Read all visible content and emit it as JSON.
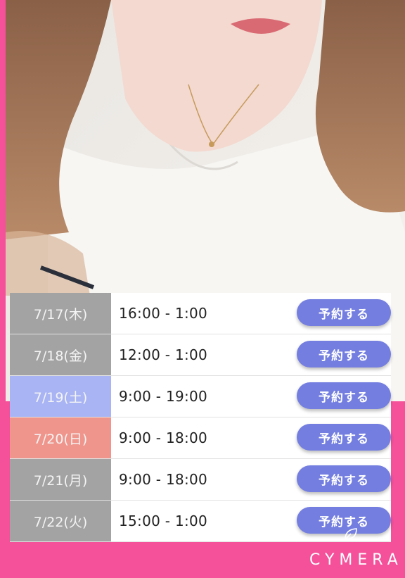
{
  "photo": {
    "alt_icon": "photo"
  },
  "schedule": {
    "reserve_label": "予約する",
    "rows": [
      {
        "date": "7/17(木)",
        "time": "16:00 - 1:00",
        "date_color": "#a3a3a3"
      },
      {
        "date": "7/18(金)",
        "time": "12:00 - 1:00",
        "date_color": "#a3a3a3"
      },
      {
        "date": "7/19(土)",
        "time": "9:00 - 19:00",
        "date_color": "#a8b4f4"
      },
      {
        "date": "7/20(日)",
        "time": "9:00 - 18:00",
        "date_color": "#f0958c"
      },
      {
        "date": "7/21(月)",
        "time": "9:00 - 18:00",
        "date_color": "#a3a3a3"
      },
      {
        "date": "7/22(火)",
        "time": "15:00 - 1:00",
        "date_color": "#a3a3a3"
      }
    ]
  },
  "watermark": {
    "text": "CYMERA",
    "icon": "cymera-leaf-icon"
  },
  "colors": {
    "background": "#f5509a",
    "button": "#737ee0"
  }
}
